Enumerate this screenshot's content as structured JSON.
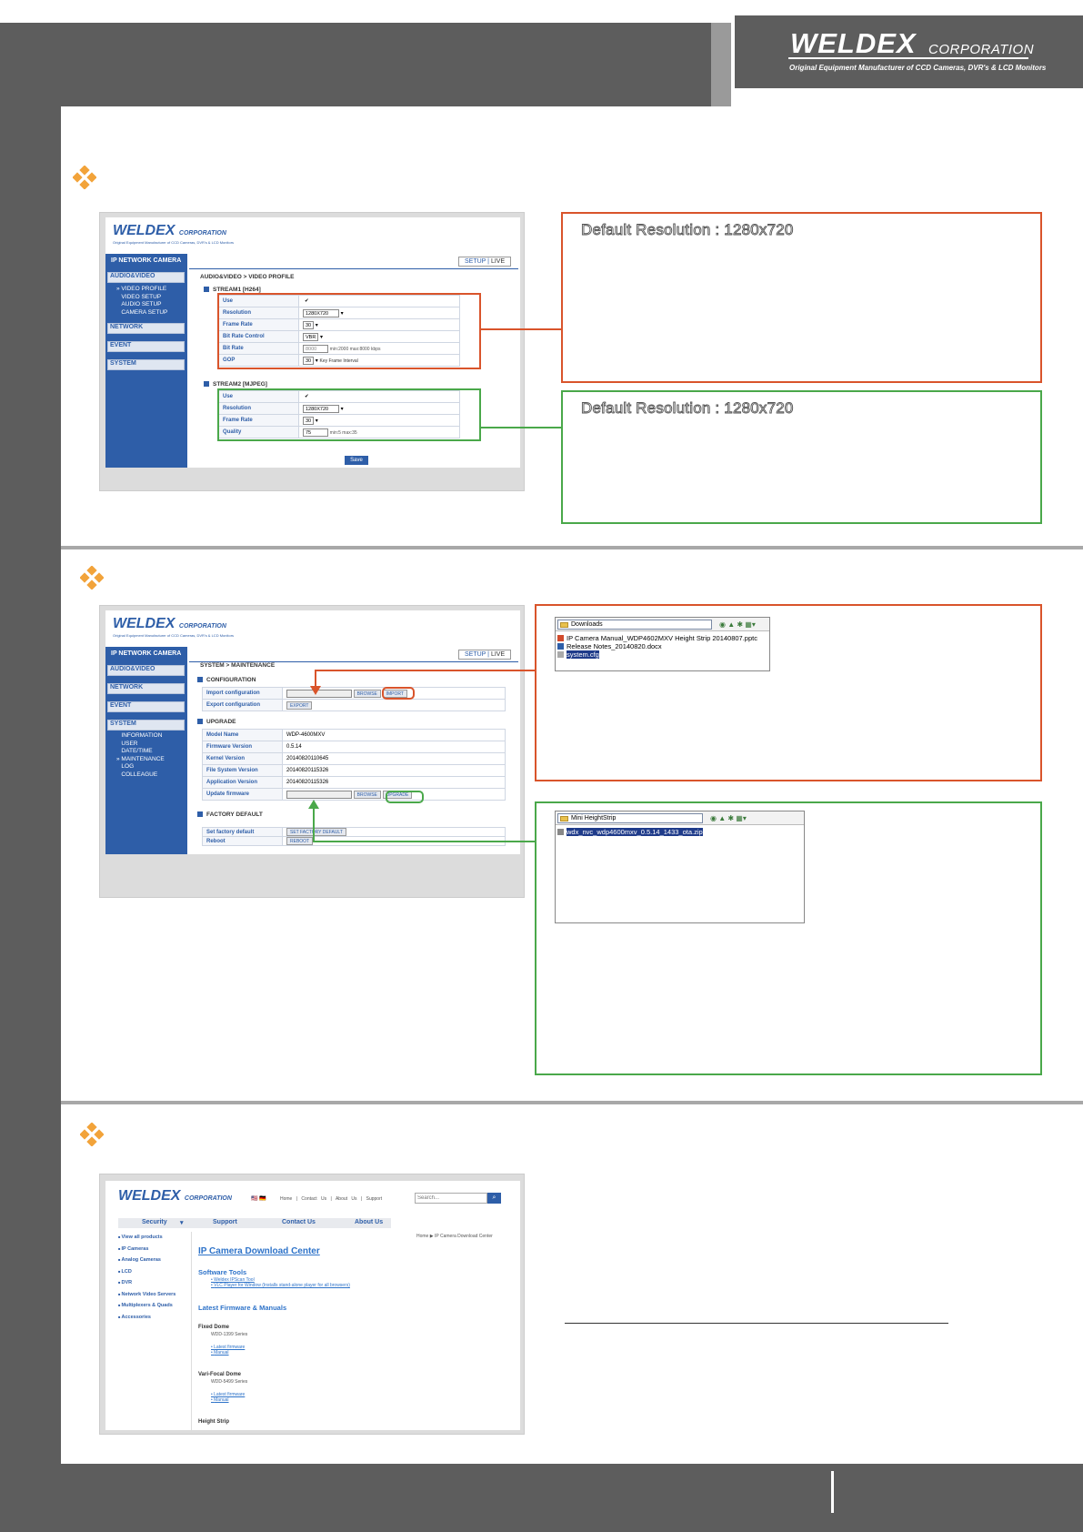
{
  "header": {
    "brand": "WELDEX",
    "brand_suffix": "CORPORATION",
    "tagline": "Original Equipment Manufacturer of CCD Cameras, DVR's & LCD Monitors"
  },
  "panel1": {
    "logo": "WELDEX",
    "logo_suffix": "CORPORATION",
    "logo_sub": "Original Equipment Manufacturer of CCD Cameras, DVR's & LCD Monitors",
    "side_title": "IP NETWORK CAMERA",
    "side_items": [
      "AUDIO&VIDEO",
      "NETWORK",
      "EVENT",
      "SYSTEM"
    ],
    "side_sub": [
      "VIDEO PROFILE",
      "VIDEO SETUP",
      "AUDIO SETUP",
      "CAMERA SETUP"
    ],
    "tab_setup": "SETUP",
    "tab_live": "LIVE",
    "breadcrumb": "AUDIO&VIDEO > VIDEO PROFILE",
    "stream1_title": "STREAM1 [H264]",
    "stream1_rows": [
      {
        "label": "Use",
        "value": "✔",
        "note": ""
      },
      {
        "label": "Resolution",
        "value": "1280X720",
        "note": ""
      },
      {
        "label": "Frame Rate",
        "value": "30",
        "note": ""
      },
      {
        "label": "Bit Rate Control",
        "value": "VBR",
        "note": ""
      },
      {
        "label": "Bit Rate",
        "value": "8000",
        "note": "min:2000 max:8000 kbps"
      },
      {
        "label": "GOP",
        "value": "30",
        "note": "Key Frame Interval"
      }
    ],
    "stream2_title": "STREAM2 [MJPEG]",
    "stream2_rows": [
      {
        "label": "Use",
        "value": "✔",
        "note": ""
      },
      {
        "label": "Resolution",
        "value": "1280X720",
        "note": ""
      },
      {
        "label": "Frame Rate",
        "value": "30",
        "note": ""
      },
      {
        "label": "Quality",
        "value": "75",
        "note": "min:5 max:35"
      }
    ],
    "save": "Save"
  },
  "callouts": {
    "red1": "Default Resolution : 1280x720",
    "green1": "Default Resolution : 1280x720"
  },
  "panel2": {
    "side_items": [
      "AUDIO&VIDEO",
      "NETWORK",
      "EVENT",
      "SYSTEM"
    ],
    "side_sub": [
      "INFORMATION",
      "USER",
      "DATE/TIME",
      "MAINTENANCE",
      "LOG",
      "COLLEAGUE"
    ],
    "breadcrumb": "SYSTEM > MAINTENANCE",
    "configuration": "CONFIGURATION",
    "import_label": "Import configuration",
    "export_label": "Export configuration",
    "browse": "BROWSE",
    "import_btn": "IMPORT",
    "export_btn": "EXPORT",
    "upgrade_title": "UPGRADE",
    "upgrade_rows": [
      {
        "label": "Model Name",
        "value": "WDP-4600MXV"
      },
      {
        "label": "Firmware Version",
        "value": "0.5.14"
      },
      {
        "label": "Kernel Version",
        "value": "20140820110645"
      },
      {
        "label": "File System Version",
        "value": "20140820115326"
      },
      {
        "label": "Application Version",
        "value": "20140820115326"
      }
    ],
    "update_label": "Update firmware",
    "upgrade_btn": "UPGRADE",
    "factory_title": "FACTORY DEFAULT",
    "set_factory_label": "Set factory default",
    "set_factory_btn": "SET FACTORY DEFAULT",
    "reboot_label": "Reboot",
    "reboot_btn": "REBOOT"
  },
  "explorer1": {
    "folder": "Downloads",
    "files": [
      "IP Camera Manual_WDP4602MXV Height Strip 20140807.pptc",
      "Release Notes_20140820.docx",
      "system.cfg"
    ]
  },
  "explorer2": {
    "folder": "Mini HeightStrip",
    "files": [
      "wdx_nvc_wdp4600mxv_0.5.14_1433_ota.zip"
    ]
  },
  "portal": {
    "logo": "WELDEX",
    "logo_suffix": "CORPORATION",
    "top_links": [
      "Home",
      "Contact Us",
      "About Us",
      "Support"
    ],
    "search_placeholder": "Search...",
    "nav": [
      "Security",
      "Support",
      "Contact Us",
      "About Us"
    ],
    "categories": [
      "View all products",
      "IP Cameras",
      "Analog Cameras",
      "LCD",
      "DVR",
      "Network Video Servers",
      "Multiplexers & Quads",
      "Accessories"
    ],
    "breadcrumb": "Home ▶ IP Camera Download Center",
    "title": "IP Camera Download Center",
    "software_tools": "Software Tools",
    "tool_links": [
      "Weldex IPScan Tool",
      "VLC Player for Window (Installs stand-alone player for all browsers)"
    ],
    "latest": "Latest Firmware & Manuals",
    "groups": [
      {
        "name": "Fixed Dome",
        "series": "WDD-1399 Series",
        "links": [
          "Latest firmware",
          "Manual"
        ]
      },
      {
        "name": "Vari-Focal Dome",
        "series": "WDD-5499 Series",
        "links": [
          "Latest firmware",
          "Manual"
        ]
      }
    ],
    "height_strip": "Height Strip"
  }
}
